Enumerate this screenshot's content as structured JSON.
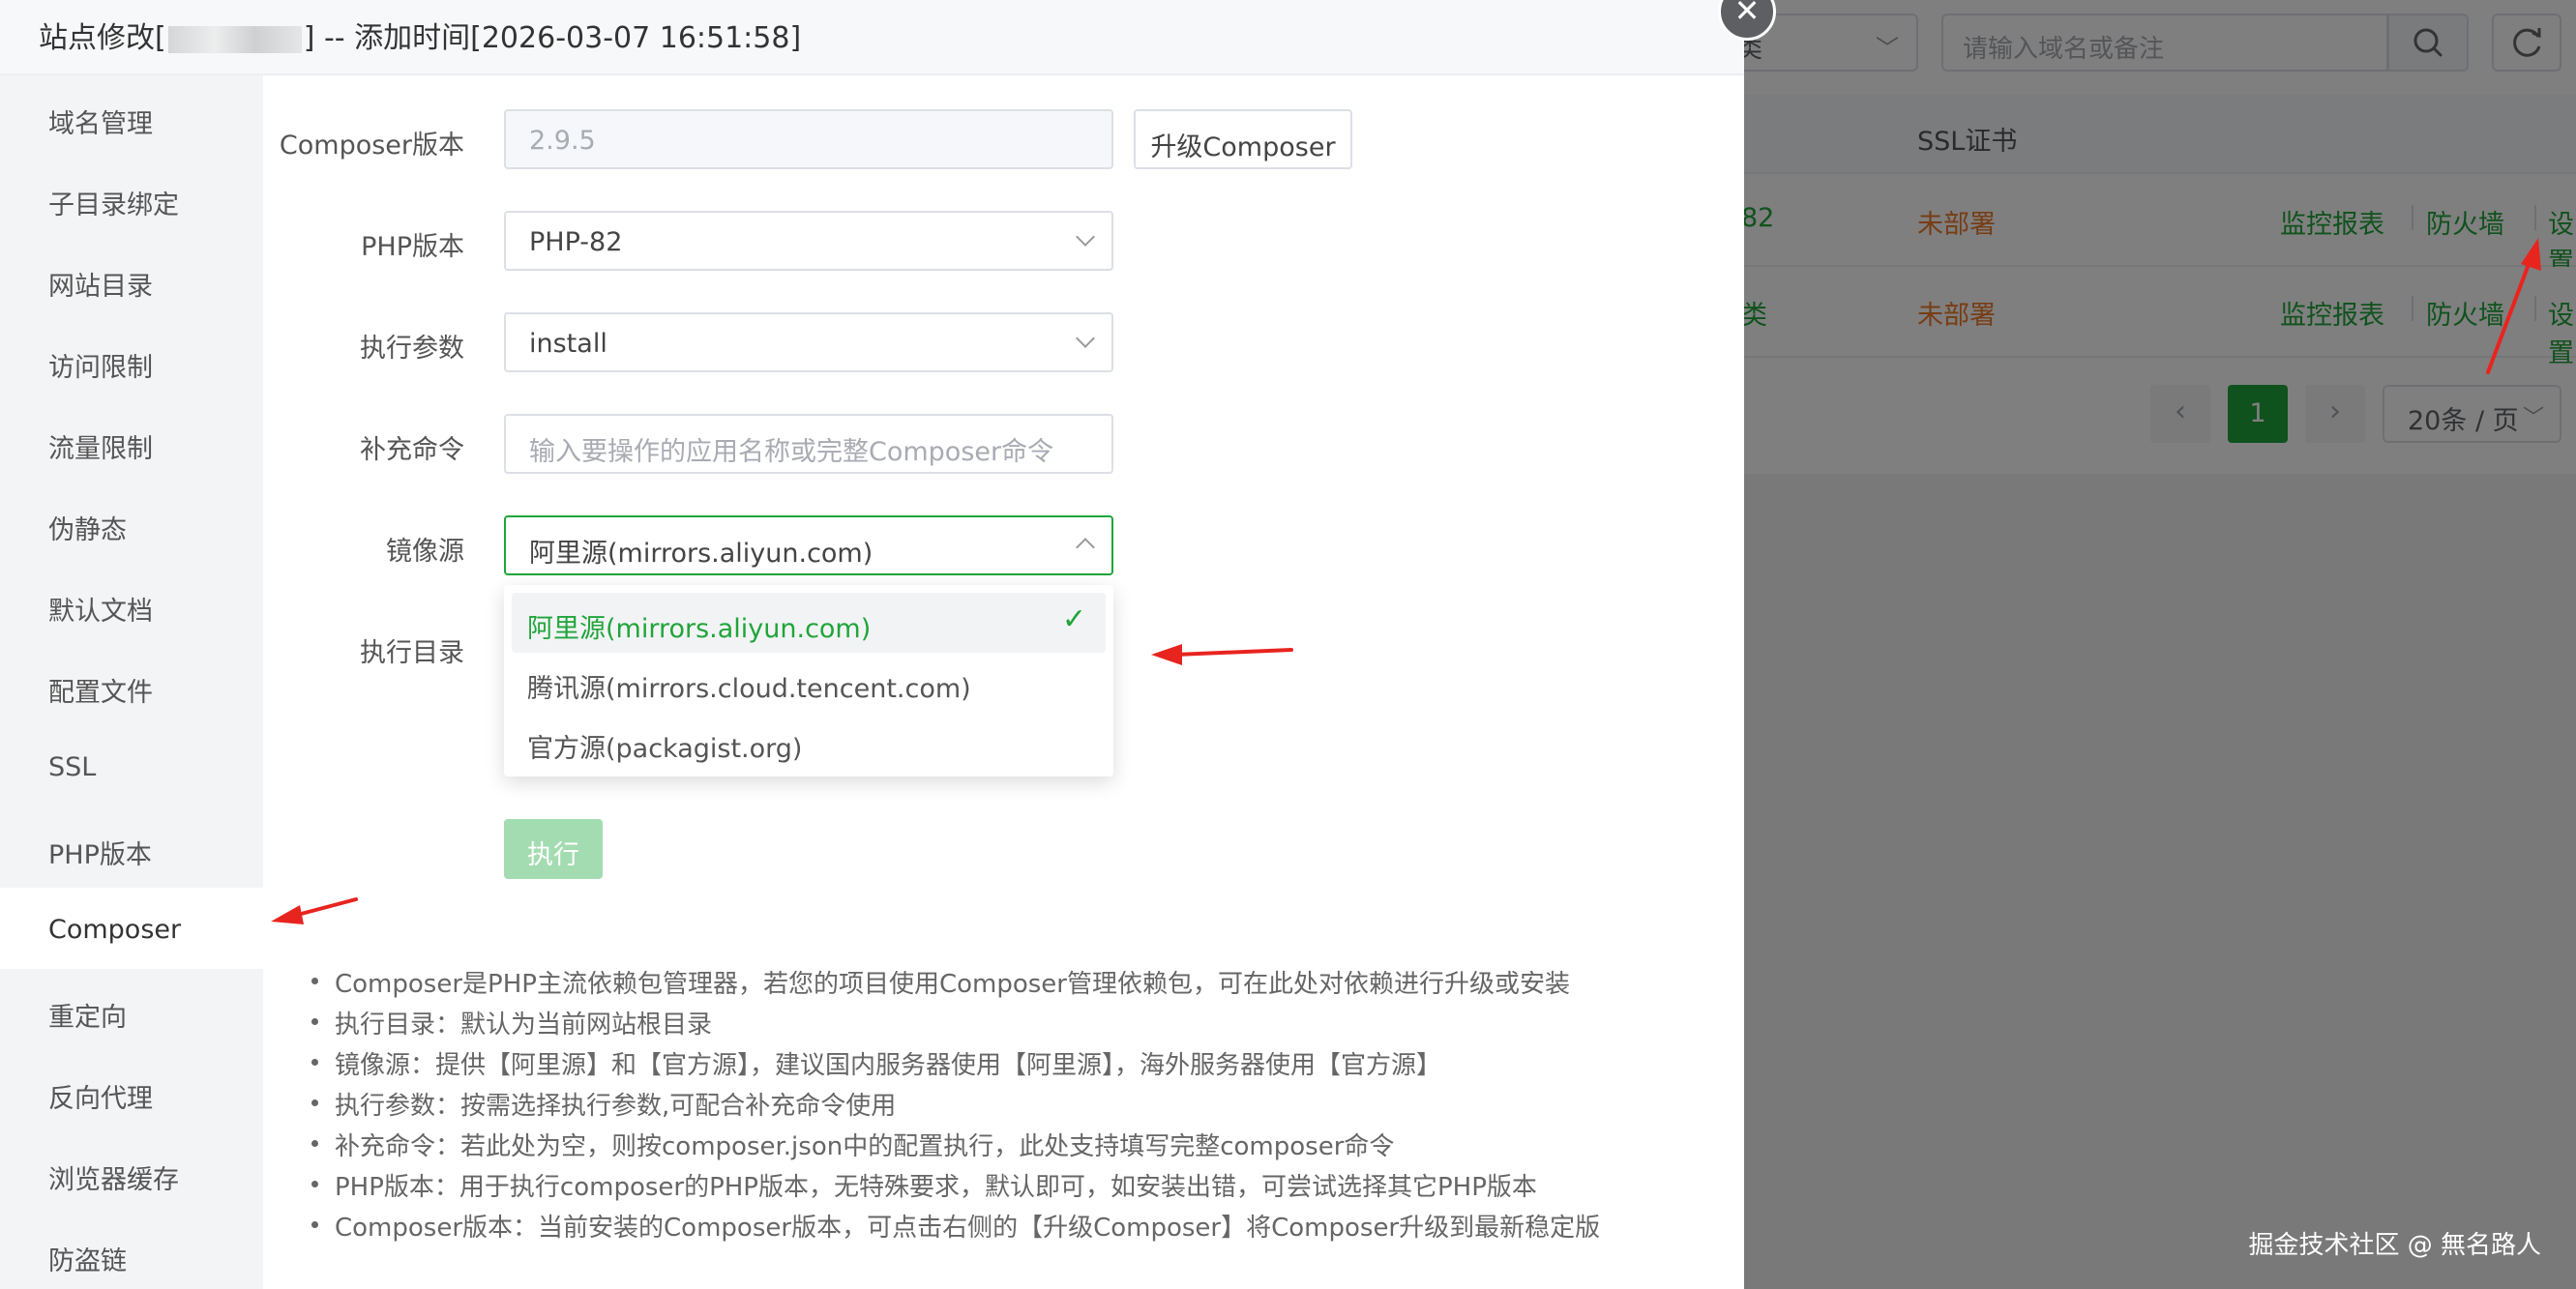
{
  "background": {
    "type_select_text": "类",
    "search_placeholder": "请输入域名或备注",
    "ssl_header": "SSL证书",
    "rows": [
      {
        "cut_text": "82",
        "ssl": "未部署",
        "op_monitor": "监控报表",
        "op_firewall": "防火墙",
        "op_settings": "设置"
      },
      {
        "cut_text": "类",
        "ssl": "未部署",
        "op_monitor": "监控报表",
        "op_firewall": "防火墙",
        "op_settings": "设置"
      }
    ],
    "pager": {
      "current": "1",
      "page_size": "20条 / 页"
    },
    "watermark": "掘金技术社区 @ 無名路人"
  },
  "dialog": {
    "title_prefix": "站点修改[",
    "title_suffix": "] -- 添加时间[2026-03-07 16:51:58]",
    "close_glyph": "✕",
    "sidebar": [
      "域名管理",
      "子目录绑定",
      "网站目录",
      "访问限制",
      "流量限制",
      "伪静态",
      "默认文档",
      "配置文件",
      "SSL",
      "PHP版本",
      "Composer",
      "重定向",
      "反向代理",
      "浏览器缓存",
      "防盗链"
    ],
    "form": {
      "composer_version_label": "Composer版本",
      "composer_version_value": "2.9.5",
      "upgrade_button": "升级Composer",
      "php_version_label": "PHP版本",
      "php_version_value": "PHP-82",
      "exec_params_label": "执行参数",
      "exec_params_value": "install",
      "extra_cmd_label": "补充命令",
      "extra_cmd_placeholder": "输入要操作的应用名称或完整Composer命令",
      "mirror_label": "镜像源",
      "mirror_value": "阿里源(mirrors.aliyun.com)",
      "exec_dir_label": "执行目录",
      "mirror_options": [
        "阿里源(mirrors.aliyun.com)",
        "腾讯源(mirrors.cloud.tencent.com)",
        "官方源(packagist.org)"
      ],
      "exec_button": "执行"
    },
    "tips": [
      "Composer是PHP主流依赖包管理器，若您的项目使用Composer管理依赖包，可在此处对依赖进行升级或安装",
      "执行目录：默认为当前网站根目录",
      "镜像源：提供【阿里源】和【官方源】，建议国内服务器使用【阿里源】，海外服务器使用【官方源】",
      "执行参数：按需选择执行参数,可配合补充命令使用",
      "补充命令：若此处为空，则按composer.json中的配置执行，此处支持填写完整composer命令",
      "PHP版本：用于执行composer的PHP版本，无特殊要求，默认即可，如安装出错，可尝试选择其它PHP版本",
      "Composer版本：当前安装的Composer版本，可点击右侧的【升级Composer】将Composer升级到最新稳定版"
    ]
  },
  "colors": {
    "accent": "#20a53a",
    "warning": "#ef7a2b",
    "annotation": "#e8241f"
  }
}
